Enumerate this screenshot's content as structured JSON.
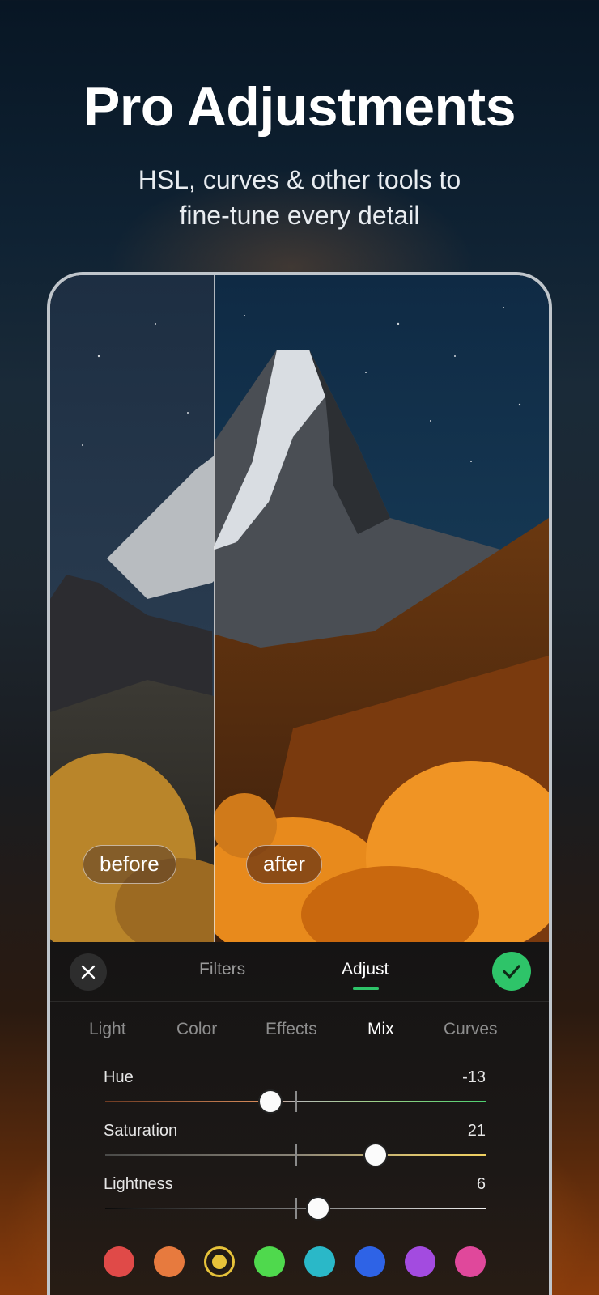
{
  "hero": {
    "title": "Pro Adjustments",
    "subtitle_line1": "HSL, curves & other tools to",
    "subtitle_line2": "fine-tune every detail"
  },
  "compare": {
    "before_label": "before",
    "after_label": "after"
  },
  "toolbar": {
    "tabs": [
      "Filters",
      "Adjust"
    ],
    "active_tab": "Adjust",
    "accent_color": "#2ec469"
  },
  "categories": {
    "items": [
      "Light",
      "Color",
      "Effects",
      "Mix",
      "Curves"
    ],
    "active": "Mix"
  },
  "sliders": [
    {
      "label": "Hue",
      "value": "-13",
      "level": -13,
      "range": [
        -100,
        100
      ]
    },
    {
      "label": "Saturation",
      "value": "21",
      "level": 21,
      "range": [
        -50,
        50
      ]
    },
    {
      "label": "Lightness",
      "value": "6",
      "level": 6,
      "range": [
        -50,
        50
      ]
    }
  ],
  "color_channels": [
    {
      "name": "red",
      "color": "#e04a48"
    },
    {
      "name": "orange",
      "color": "#e77a3e"
    },
    {
      "name": "yellow",
      "color": "#e6c23a",
      "selected": true
    },
    {
      "name": "green",
      "color": "#4fd94d"
    },
    {
      "name": "aqua",
      "color": "#2ab8c8"
    },
    {
      "name": "blue",
      "color": "#2e63e6"
    },
    {
      "name": "purple",
      "color": "#a34be0"
    },
    {
      "name": "magenta",
      "color": "#e0489b"
    }
  ]
}
